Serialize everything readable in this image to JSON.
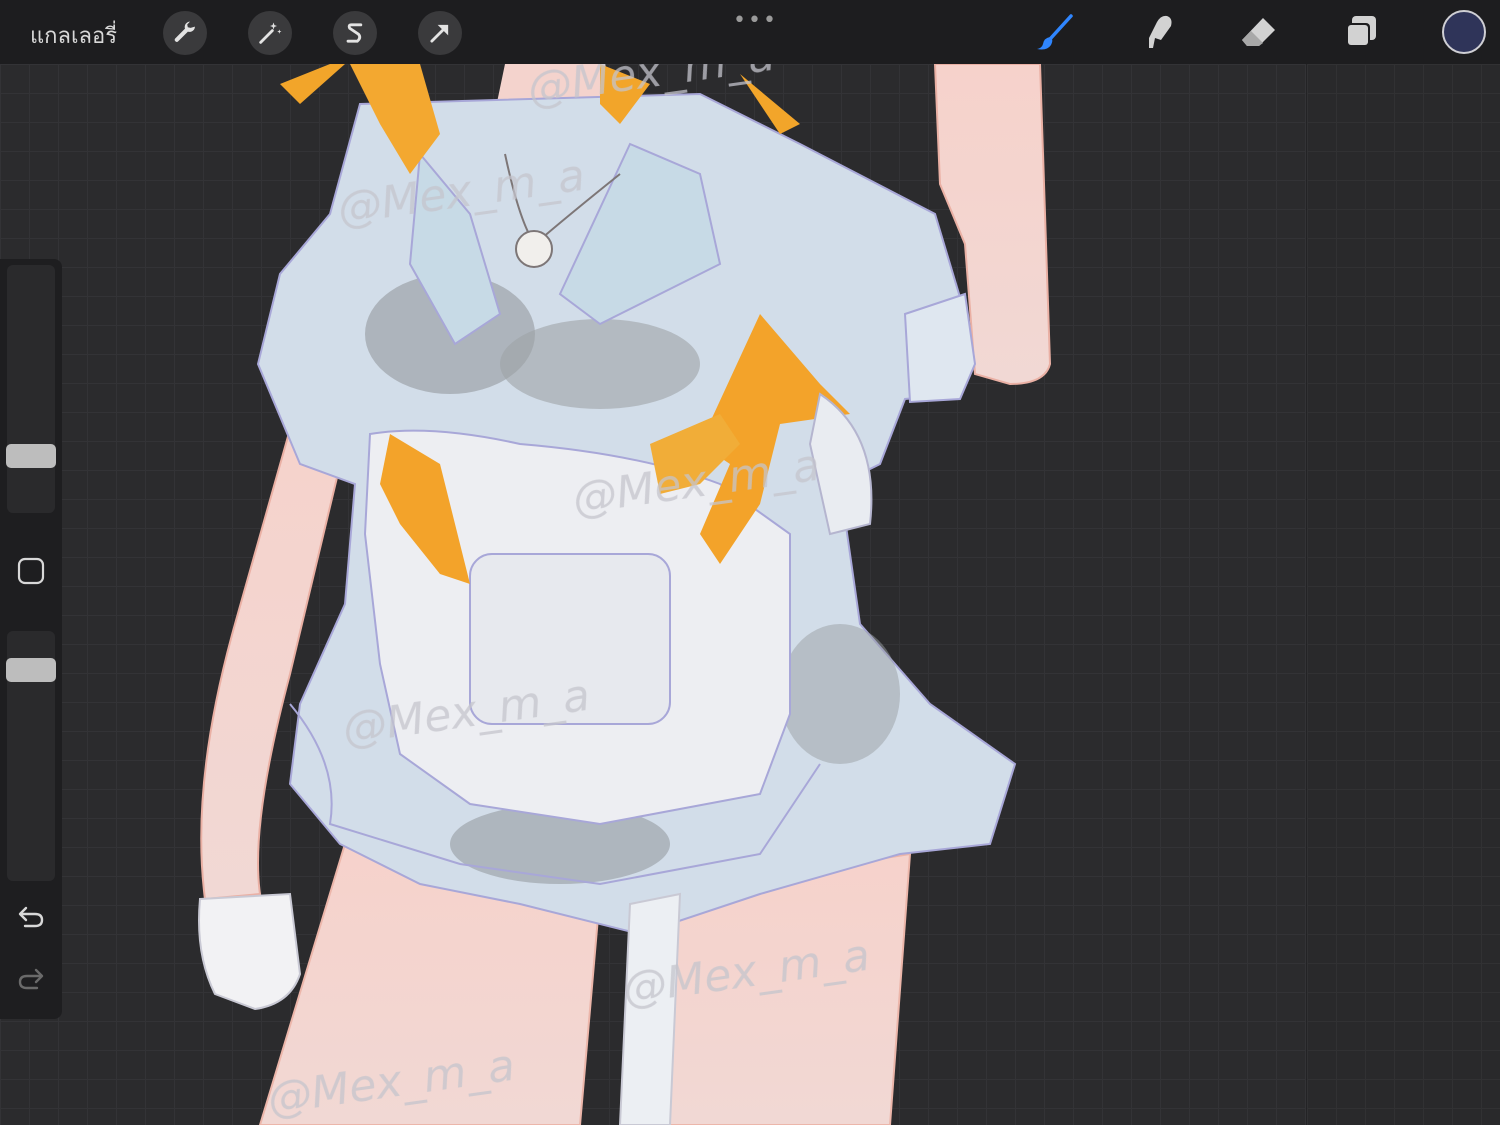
{
  "topbar": {
    "gallery_label": "แกลเลอรี่",
    "more_label": "•••",
    "tools": [
      "wrench-icon",
      "magic-wand-icon",
      "selection-s-icon",
      "transform-arrow-icon"
    ],
    "right_tools": [
      "brush-icon",
      "smudge-icon",
      "eraser-icon",
      "layers-icon"
    ],
    "active_tool": "brush",
    "active_color": "#2f3459",
    "accent": "#2f86ff"
  },
  "sidebar": {
    "brush_size_level": 0.2,
    "opacity_level": 0.88,
    "modify_button": "square-icon",
    "undo_icon": "undo-icon",
    "redo_icon": "redo-icon"
  },
  "artwork": {
    "watermark": "@Mex_m_a"
  }
}
